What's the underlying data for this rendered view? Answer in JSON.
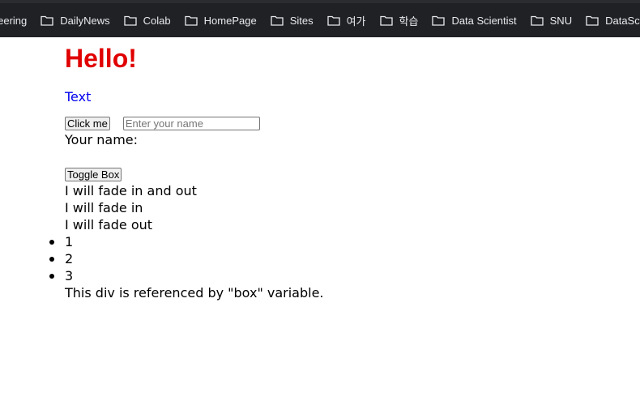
{
  "bookmarks": [
    {
      "label": "ineering",
      "icon": "folder-icon"
    },
    {
      "label": "DailyNews",
      "icon": "folder-icon"
    },
    {
      "label": "Colab",
      "icon": "folder-icon"
    },
    {
      "label": "HomePage",
      "icon": "folder-icon"
    },
    {
      "label": "Sites",
      "icon": "folder-icon"
    },
    {
      "label": "여가",
      "icon": "folder-icon"
    },
    {
      "label": "학습",
      "icon": "folder-icon"
    },
    {
      "label": "Data Scientist",
      "icon": "folder-icon"
    },
    {
      "label": "SNU",
      "icon": "folder-icon"
    },
    {
      "label": "DataScie",
      "icon": "folder-icon"
    }
  ],
  "page": {
    "heading": "Hello!",
    "text_link": "Text",
    "click_button": "Click me",
    "name_placeholder": "Enter your name",
    "your_name_label": "Your name:",
    "toggle_button": "Toggle Box",
    "fade_in_out": "I will fade in and out",
    "fade_in": "I will fade in",
    "fade_out": "I will fade out",
    "list_items": [
      "1",
      "2",
      "3"
    ],
    "box_text": "This div is referenced by \"box\" variable."
  },
  "colors": {
    "heading": "#e00000",
    "link": "#0000ee",
    "bookmarks_bg": "#202124",
    "bookmarks_text": "#e8eaed"
  }
}
